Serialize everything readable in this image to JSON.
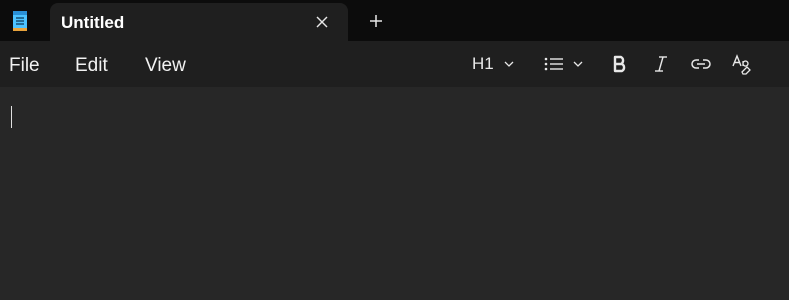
{
  "window": {
    "app_icon": "notepad-icon",
    "tab": {
      "title": "Untitled",
      "close_icon": "close-icon"
    },
    "new_tab_icon": "plus-icon"
  },
  "menu": {
    "file_label": "File",
    "edit_label": "Edit",
    "view_label": "View"
  },
  "toolbar": {
    "heading_value": "H1",
    "heading_icon": "chevron-down-icon",
    "list_icon": "bulleted-list-icon",
    "bold_icon": "bold-icon",
    "italic_icon": "italic-icon",
    "link_icon": "link-icon",
    "clear_formatting_icon": "clear-formatting-icon"
  },
  "editor": {
    "content": ""
  },
  "colors": {
    "titlebar_bg": "#0c0c0c",
    "tab_bg": "#1f1f1f",
    "menubar_bg": "#1f1f1f",
    "editor_bg": "#272727",
    "text": "#f2f2f2",
    "app_icon_accent": "#4cc2ff"
  }
}
